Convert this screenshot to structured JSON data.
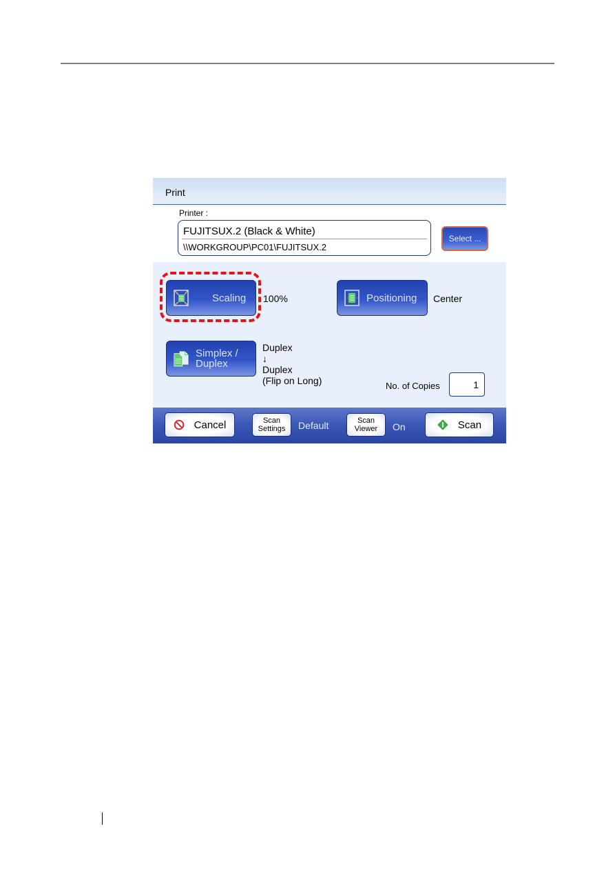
{
  "window": {
    "title": "Print"
  },
  "printer": {
    "label": "Printer :",
    "name": "FUJITSUX.2 (Black & White)",
    "path": "\\\\WORKGROUP\\PC01\\FUJITSUX.2",
    "select_label": "Select ..."
  },
  "options": {
    "scaling": {
      "label": "Scaling",
      "value": "100%",
      "icon": "scaling-icon"
    },
    "positioning": {
      "label": "Positioning",
      "value": "Center",
      "icon": "positioning-icon"
    },
    "simplex": {
      "label_line1": "Simplex /",
      "label_line2": "Duplex",
      "value_line1": "Duplex",
      "value_arrow": "↓",
      "value_line2": "Duplex",
      "value_line3": "(Flip on Long)",
      "icon": "simplex-duplex-icon"
    },
    "copies": {
      "label": "No. of Copies",
      "value": "1"
    }
  },
  "bottom_bar": {
    "cancel_label": "Cancel",
    "scan_settings_line1": "Scan",
    "scan_settings_line2": "Settings",
    "scan_settings_value": "Default",
    "scan_viewer_line1": "Scan",
    "scan_viewer_line2": "Viewer",
    "scan_viewer_value": "On",
    "scan_label": "Scan"
  },
  "colors": {
    "highlight_ring": "#e3121b",
    "button_blue": "#3356c8",
    "panel_bg": "#e8f1fb"
  }
}
